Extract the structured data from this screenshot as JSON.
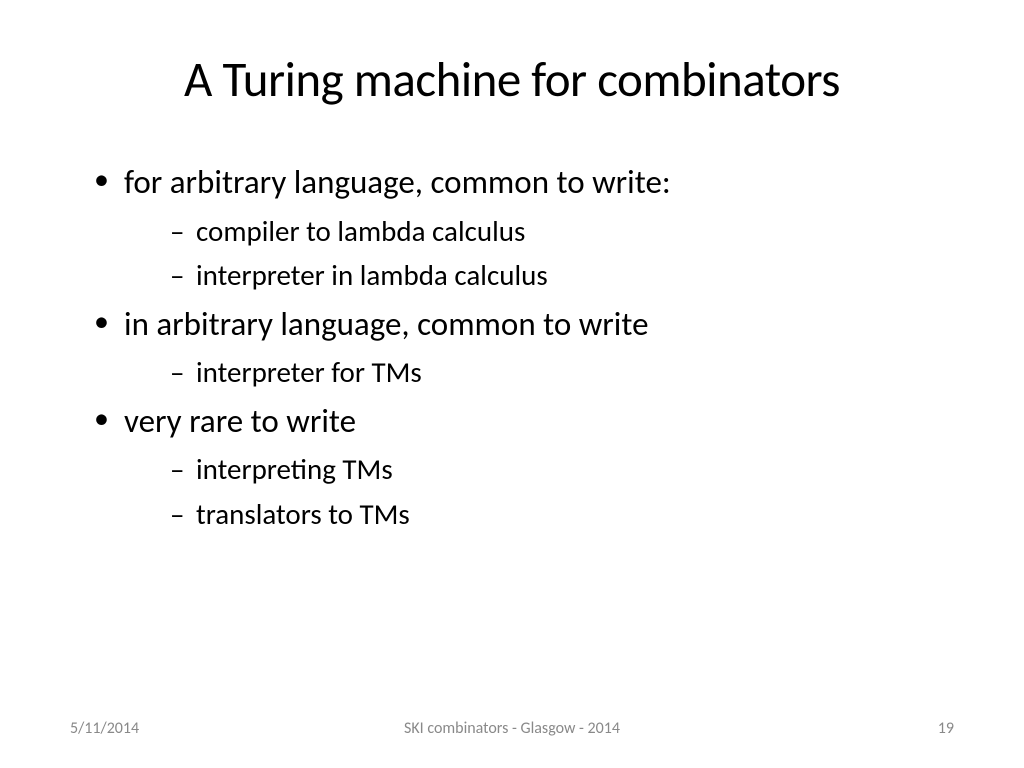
{
  "title": "A Turing machine for combinators",
  "bullets": [
    {
      "text": "for arbitrary language, common to write:",
      "sub": [
        "compiler to lambda calculus",
        "interpreter in lambda calculus"
      ]
    },
    {
      "text": "in arbitrary language, common to write",
      "sub": [
        "interpreter for TMs"
      ]
    },
    {
      "text": "very rare to write",
      "sub": [
        "interpreting TMs",
        "translators to TMs"
      ]
    }
  ],
  "footer": {
    "date": "5/11/2014",
    "center": "SKI combinators - Glasgow - 2014",
    "page": "19"
  }
}
